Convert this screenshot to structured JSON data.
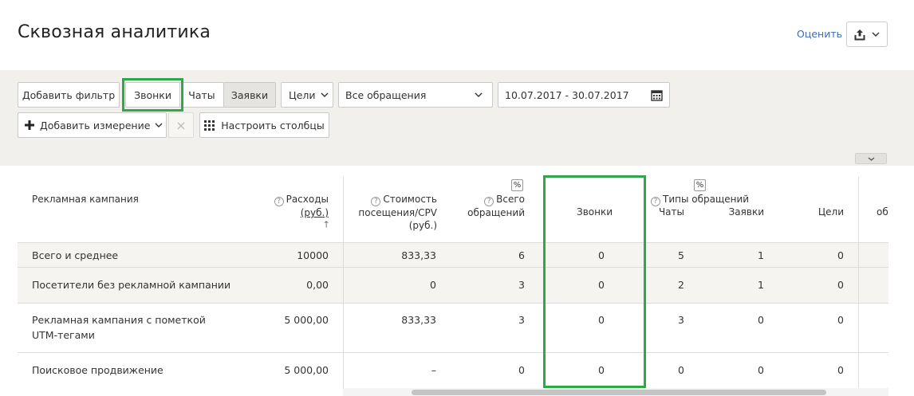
{
  "header": {
    "title": "Сквозная аналитика",
    "rate_label": "Оценить"
  },
  "filters": {
    "add_filter": "Добавить фильтр",
    "type_tabs": [
      "Звонки",
      "Чаты",
      "Заявки"
    ],
    "goals": "Цели",
    "appeals_select": "Все обращения",
    "date_range": "10.07.2017 - 30.07.2017",
    "add_dimension": "Добавить измерение",
    "remove": "×",
    "configure_columns": "Настроить столбцы"
  },
  "table": {
    "headers": {
      "campaign": "Рекламная кампания",
      "expenses_1": "Расходы",
      "expenses_2": "(руб.)",
      "cost_1": "Стоимость",
      "cost_2": "посещения/CPV",
      "cost_3": "(руб.)",
      "total_1": "Всего",
      "total_2": "обращений",
      "pct": "%",
      "calls": "Звонки",
      "types_group": "Типы обращений",
      "chats": "Чаты",
      "requests": "Заявки",
      "goals": "Цели",
      "cut": "об"
    },
    "rows": [
      {
        "name": "Всего и среднее",
        "expenses": "10000",
        "cost": "833,33",
        "total": "6",
        "calls": "0",
        "chats": "5",
        "requests": "1",
        "goals": "0"
      },
      {
        "name": "Посетители без рекламной кампании",
        "expenses": "0,00",
        "cost": "0",
        "total": "3",
        "calls": "0",
        "chats": "2",
        "requests": "1",
        "goals": "0"
      },
      {
        "name_1": "Рекламная кампания с пометкой",
        "name_2": "UTM-тегами",
        "expenses": "5 000,00",
        "cost": "833,33",
        "total": "3",
        "calls": "0",
        "chats": "3",
        "requests": "0",
        "goals": "0"
      },
      {
        "name": "Поисковое продвижение",
        "expenses": "5 000,00",
        "cost": "–",
        "total": "0",
        "calls": "0",
        "chats": "0",
        "requests": "0",
        "goals": "0"
      }
    ]
  },
  "colors": {
    "highlight": "#2fa84a",
    "link": "#3a6fb0",
    "toolbar_bg": "#f2f0ec"
  }
}
